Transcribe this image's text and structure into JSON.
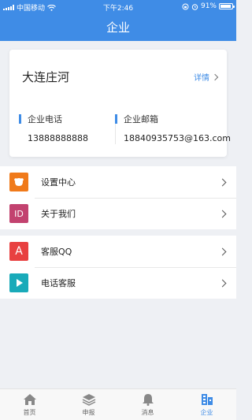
{
  "status": {
    "carrier": "中国移动",
    "time": "下午2:46",
    "battery": "91%"
  },
  "header": {
    "title": "企业"
  },
  "company": {
    "name": "大连庄河",
    "detail_label": "详情",
    "phone_label": "企业电话",
    "phone_value": "13888888888",
    "email_label": "企业邮箱",
    "email_value": "18840935753@163.com"
  },
  "menu": {
    "group1": [
      {
        "label": "设置中心",
        "icon": "settings-icon",
        "color": "#f07a1a"
      },
      {
        "label": "关于我们",
        "icon": "about-icon",
        "color": "#c2426f",
        "glyph": "ID"
      }
    ],
    "group2": [
      {
        "label": "客服QQ",
        "icon": "qq-service-icon",
        "color": "#e84040",
        "glyph": "A"
      },
      {
        "label": "电话客服",
        "icon": "phone-service-icon",
        "color": "#19aab9"
      }
    ]
  },
  "tabbar": [
    {
      "label": "首页",
      "icon": "home-icon"
    },
    {
      "label": "申报",
      "icon": "layers-icon"
    },
    {
      "label": "消息",
      "icon": "bell-icon"
    },
    {
      "label": "企业",
      "icon": "building-icon",
      "active": true
    }
  ],
  "colors": {
    "primary": "#3f8ce6",
    "background": "#eef0f4"
  }
}
